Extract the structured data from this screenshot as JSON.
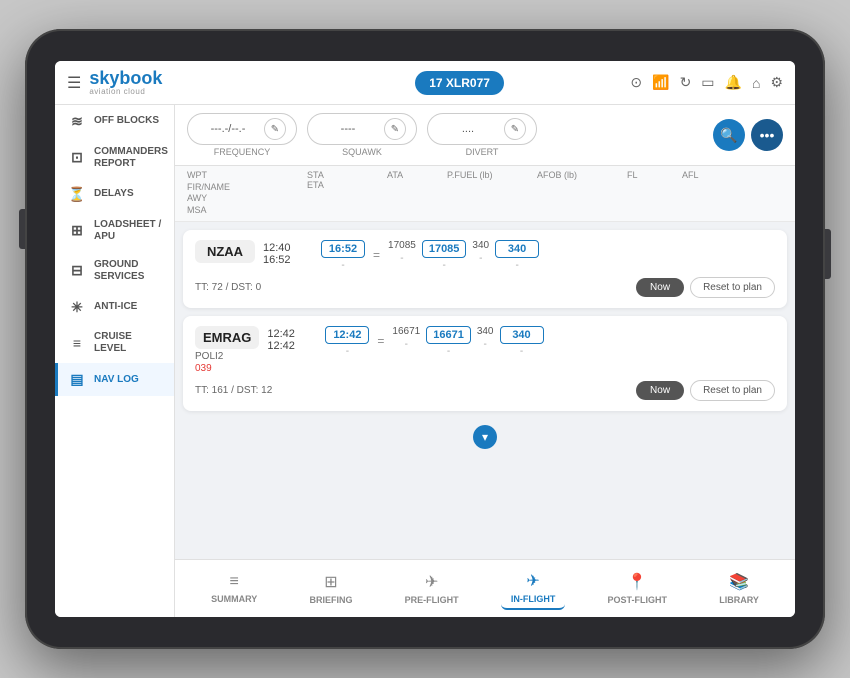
{
  "app": {
    "logo": "skybook",
    "logo_sub": "aviation cloud",
    "hamburger": "☰",
    "flight_id": "17 XLR077"
  },
  "top_icons": [
    "🔔",
    "📡",
    "⚙️",
    "📱",
    "🔔",
    "🏠",
    "☰"
  ],
  "controls": {
    "frequency": {
      "value": "---.-/--.-",
      "label": "FREQUENCY"
    },
    "squawk": {
      "value": "----",
      "label": "SQUAWK"
    },
    "divert": {
      "value": "....",
      "label": "DIVERT"
    },
    "search_btn": "🔍",
    "more_btn": "•••"
  },
  "table_header": {
    "col1": "WPT\nFIR/NAME\nAWY\nMSA",
    "col2": "STA\nETA",
    "col3": "ATA",
    "col4": "P.FUEL (lb)",
    "col5": "AFOB (lb)",
    "col6": "FL",
    "col7": "AFL"
  },
  "sidebar": {
    "items": [
      {
        "id": "off-blocks",
        "icon": "≋",
        "label": "OFF BLOCKS"
      },
      {
        "id": "commanders-report",
        "icon": "⊡",
        "label": "COMMANDERS\nREPORT"
      },
      {
        "id": "delays",
        "icon": "⏳",
        "label": "DELAYS"
      },
      {
        "id": "loadsheet",
        "icon": "📦",
        "label": "LOADSHEET /\nAPU"
      },
      {
        "id": "ground-services",
        "icon": "🚌",
        "label": "GROUND\nSERVICES"
      },
      {
        "id": "anti-ice",
        "icon": "❄️",
        "label": "ANTI-ICE"
      },
      {
        "id": "cruise-level",
        "icon": "≡",
        "label": "CRUISE LEVEL"
      },
      {
        "id": "nav-log",
        "icon": "📋",
        "label": "NAV LOG"
      }
    ]
  },
  "nav_rows": [
    {
      "wpt": "NZAA",
      "time1": "12:40",
      "time2": "16:52",
      "ata": "16:52",
      "pfuel_plan": "17085",
      "pfuel_actual": "17085",
      "fl_plan": "340",
      "fl_actual": "340",
      "tt": "TT: 72 / DST: 0",
      "sub1": "",
      "sub2": "",
      "sub3": ""
    },
    {
      "wpt": "EMRAG",
      "time1": "12:42",
      "time2": "12:42",
      "ata": "12:42",
      "pfuel_plan": "16671",
      "pfuel_actual": "16671",
      "fl_plan": "340",
      "fl_actual": "340",
      "tt": "TT: 161 / DST: 12",
      "sub1": "POLI2",
      "sub2": "039",
      "sub2_red": true,
      "sub3": ""
    }
  ],
  "bottom_tabs": [
    {
      "id": "summary",
      "icon": "≡",
      "label": "SUMMARY",
      "active": false
    },
    {
      "id": "briefing",
      "icon": "🖼",
      "label": "BRIEFING",
      "active": false
    },
    {
      "id": "pre-flight",
      "icon": "✈",
      "label": "PRE-FLIGHT",
      "active": false
    },
    {
      "id": "in-flight",
      "icon": "✈",
      "label": "IN-FLIGHT",
      "active": true
    },
    {
      "id": "post-flight",
      "icon": "📍",
      "label": "POST-FLIGHT",
      "active": false
    },
    {
      "id": "library",
      "icon": "📚",
      "label": "LIBRARY",
      "active": false
    }
  ]
}
